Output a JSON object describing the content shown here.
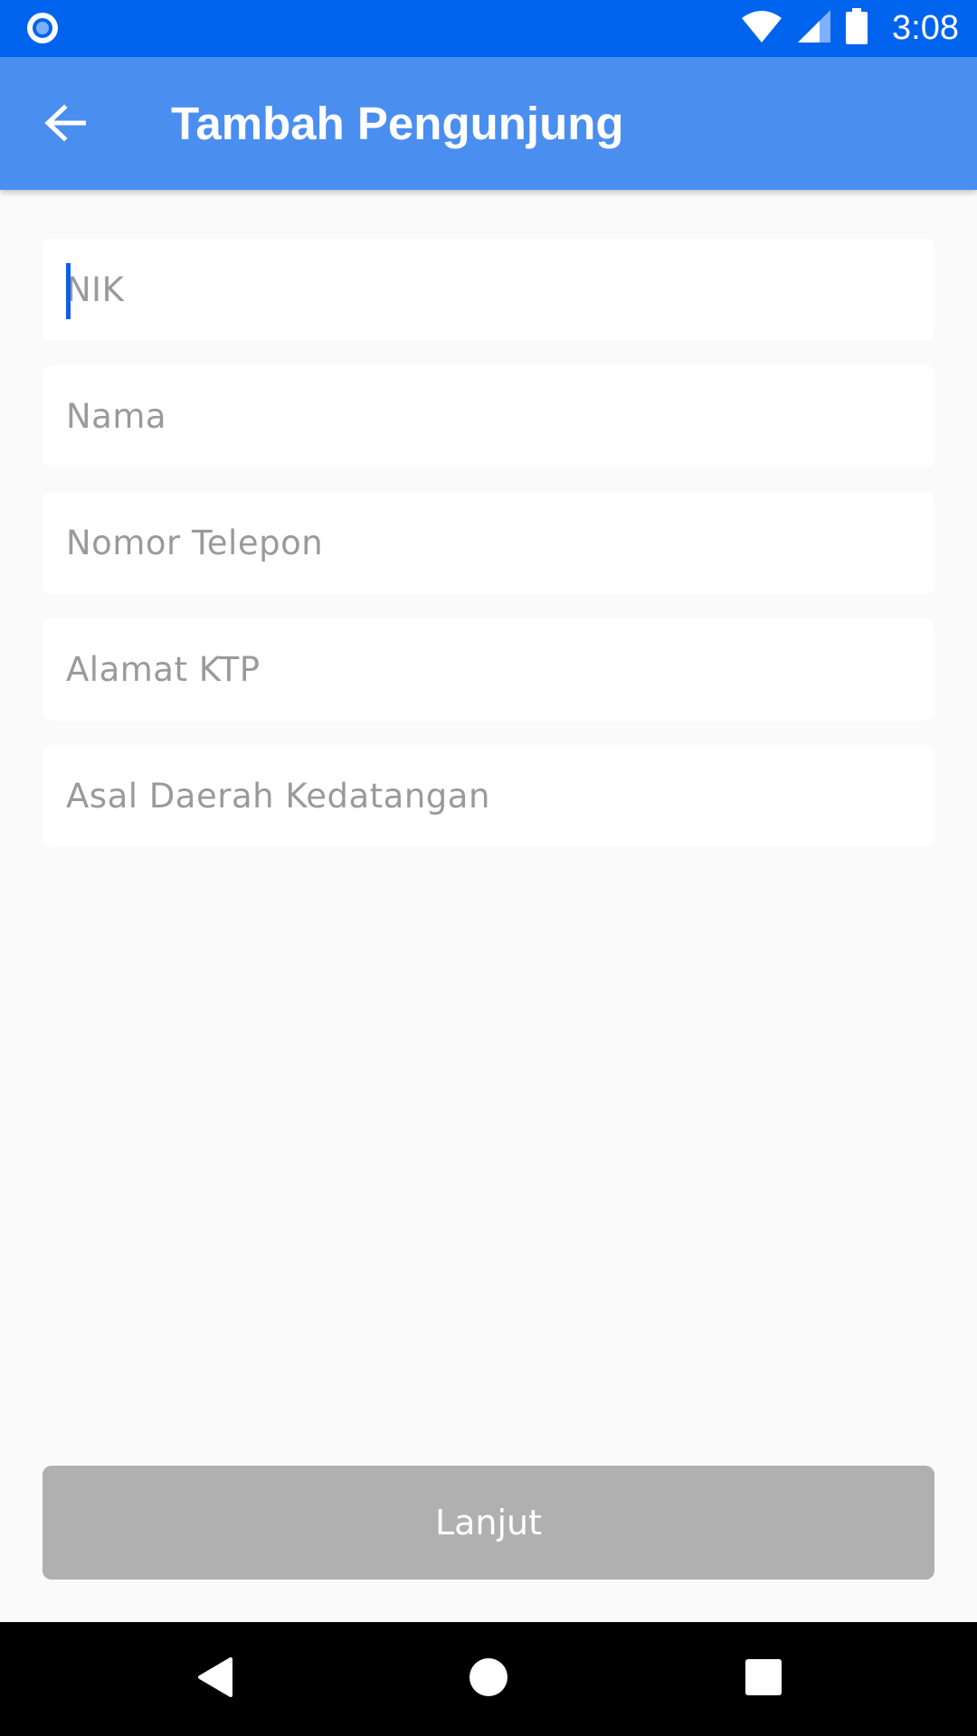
{
  "status_bar": {
    "time": "3:08",
    "icons": [
      "app-notification-icon",
      "wifi-icon",
      "cellular-signal-icon",
      "battery-icon"
    ]
  },
  "app_bar": {
    "title": "Tambah Pengunjung",
    "back_icon": "arrow-back-icon"
  },
  "form": {
    "fields": [
      {
        "placeholder": "NIK",
        "value": "",
        "focused": true
      },
      {
        "placeholder": "Nama",
        "value": ""
      },
      {
        "placeholder": "Nomor Telepon",
        "value": ""
      },
      {
        "placeholder": "Alamat KTP",
        "value": ""
      },
      {
        "placeholder": "Asal Daerah Kedatangan",
        "value": ""
      }
    ]
  },
  "actions": {
    "next_label": "Lanjut"
  },
  "nav_bar": {
    "icons": [
      "back-triangle-icon",
      "home-circle-icon",
      "recents-square-icon"
    ]
  },
  "colors": {
    "status_bar": "#0063ee",
    "app_bar": "#4a8ef0",
    "background": "#fafafa",
    "button_disabled": "#b0b0b0",
    "caret": "#0f5ee8"
  }
}
